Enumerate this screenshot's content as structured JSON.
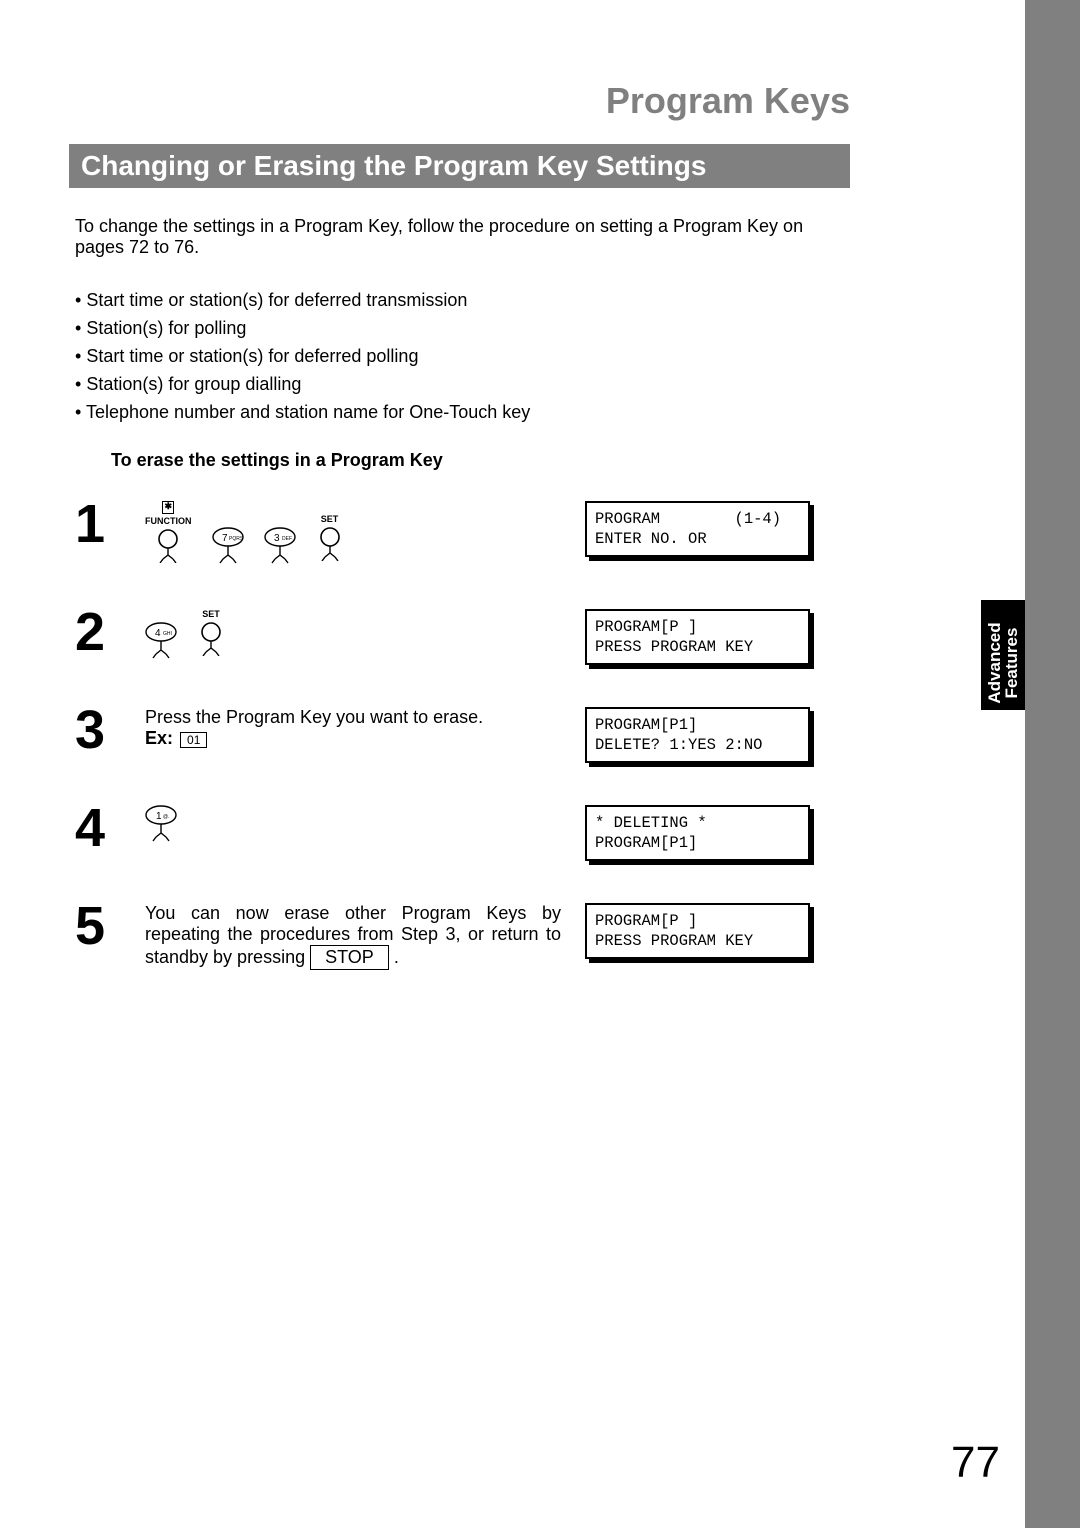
{
  "headings": {
    "title": "Program Keys",
    "section": "Changing or Erasing the Program Key Settings",
    "sub": "To erase the settings in a Program Key"
  },
  "intro": "To change the settings in a Program Key, follow the procedure on setting a Program Key on pages 72 to 76.",
  "bullets": [
    "Start time or station(s) for deferred transmission",
    "Station(s) for polling",
    "Start time or station(s) for deferred polling",
    "Station(s) for group dialling",
    "Telephone number and station name for One-Touch key"
  ],
  "tab": {
    "line1": "Advanced",
    "line2": "Features"
  },
  "page_number": "77",
  "key": {
    "function": "FUNCTION",
    "set": "SET",
    "k7": {
      "num": "7",
      "sub": "PQRS"
    },
    "k3": {
      "num": "3",
      "sub": "DEF"
    },
    "k4": {
      "num": "4",
      "sub": "GHI"
    },
    "k1": {
      "num": "1",
      "sub": "@."
    },
    "star": "✱"
  },
  "steps": {
    "s1": {
      "num": "1",
      "display": "PROGRAM        (1-4)\nENTER NO. OR"
    },
    "s2": {
      "num": "2",
      "display": "PROGRAM[P ]\nPRESS PROGRAM KEY"
    },
    "s3": {
      "num": "3",
      "text": "Press the Program Key you want to erase.",
      "ex_label": "Ex:",
      "ex_val": "01",
      "display": "PROGRAM[P1]\nDELETE? 1:YES 2:NO"
    },
    "s4": {
      "num": "4",
      "display": "* DELETING *\nPROGRAM[P1]"
    },
    "s5": {
      "num": "5",
      "text_a": "You can now erase other Program Keys by repeating the procedures from Step 3, or return to standby by pressing",
      "stop": "STOP",
      "text_b": ".",
      "display": "PROGRAM[P ]\nPRESS PROGRAM KEY"
    }
  }
}
